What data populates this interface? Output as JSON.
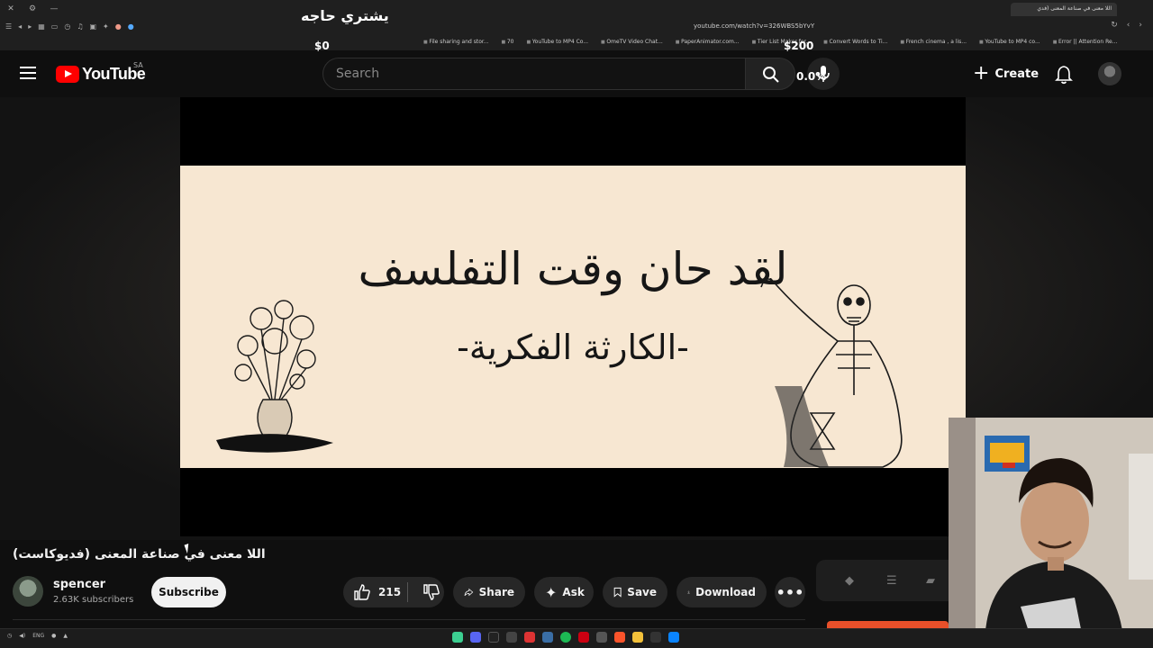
{
  "browser": {
    "active_tab_title": "اللا معنى في صناعة المعنى (فدي",
    "url": "youtube.com/watch?v=326WBS5bYvY",
    "bookmarks": [
      "File sharing and stor...",
      "70",
      "YouTube to MP4 Co...",
      "OmeTV Video Chat...",
      "PaperAnimator.com...",
      "Tier List Maker for...",
      "Convert Words to Ti...",
      "French cinema , a lis...",
      "YouTube to MP4 co...",
      "Error || Attention Re..."
    ]
  },
  "stream_overlay": {
    "arabic_text": "يشتري حاجه",
    "amount_left": "$0",
    "amount_right": "$200",
    "percent": "0.0%"
  },
  "header": {
    "logo_text": "YouTube",
    "country_code": "SA",
    "search_placeholder": "Search",
    "create_label": "Create"
  },
  "video": {
    "frame_title": "لقد حان وقت التفلسف",
    "frame_subtitle": "-الكارثة الفكرية-",
    "frame_bg": "#f7e7d2"
  },
  "info": {
    "title": "اللا معنى في صناعة المعنى (فديوكاست)",
    "channel_name": "spencer",
    "subscribers": "2.63K subscribers",
    "subscribe_label": "Subscribe",
    "like_count": "215",
    "share_label": "Share",
    "ask_label": "Ask",
    "save_label": "Save",
    "download_label": "Download"
  },
  "taskbar": {
    "language": "ENG"
  },
  "colors": {
    "accent_red": "#ff0000",
    "background": "#0f0f0f",
    "pill": "#272727"
  }
}
